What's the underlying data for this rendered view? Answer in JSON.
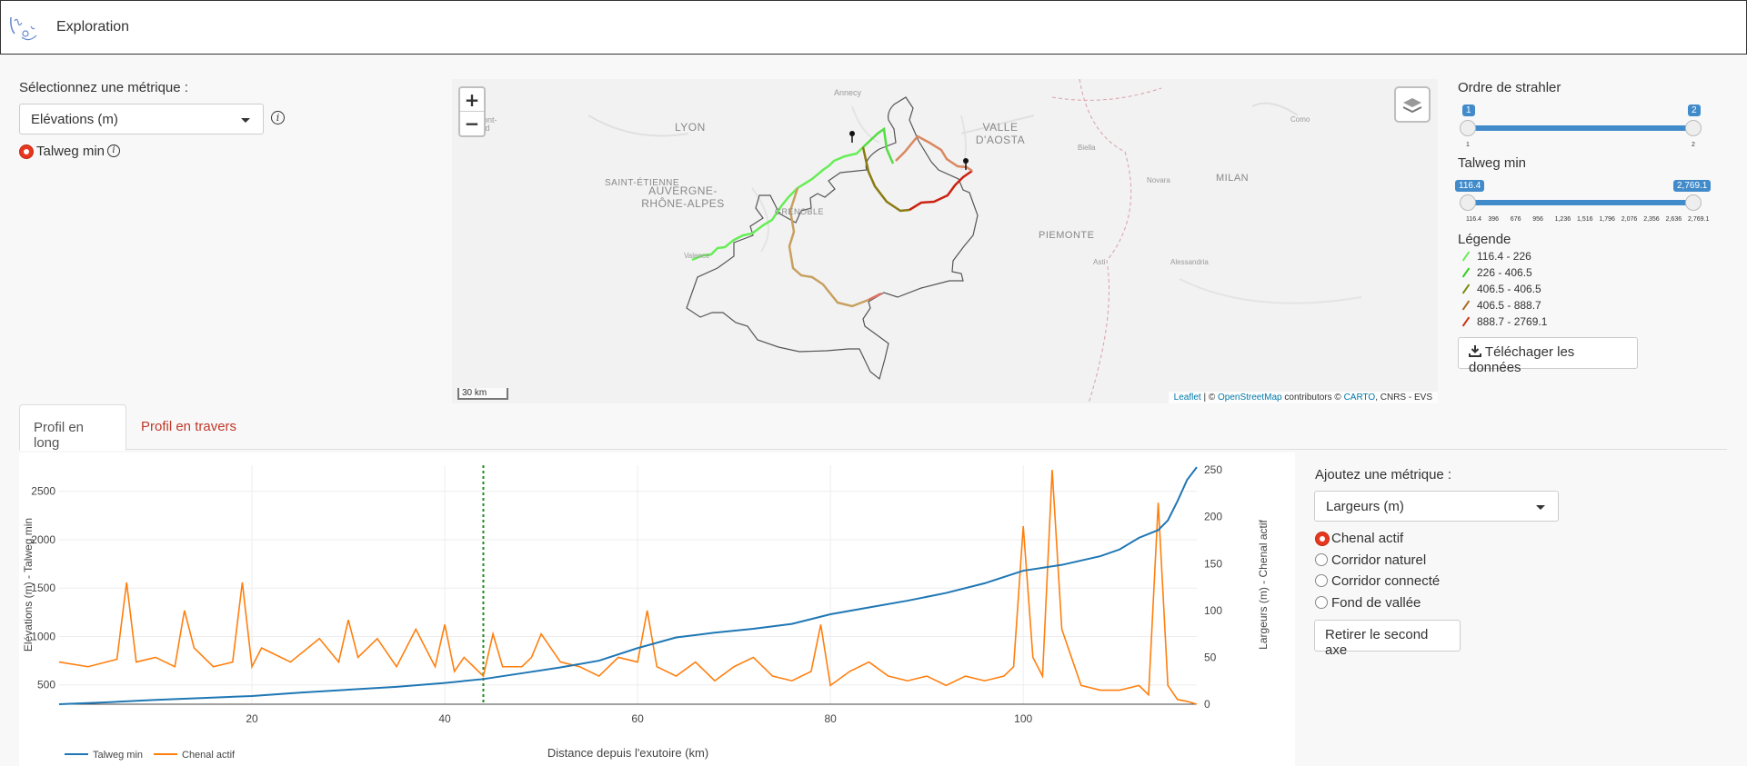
{
  "header": {
    "title": "Exploration"
  },
  "metric_panel": {
    "label": "Sélectionnez une métrique :",
    "select_value": "Elévations (m)",
    "options": [
      "Talweg min"
    ]
  },
  "map": {
    "zoom_in": "+",
    "zoom_out": "−",
    "scale": "30 km",
    "attribution": {
      "leaflet": "Leaflet",
      "sep1": " | © ",
      "osm": "OpenStreetMap",
      "contrib": " contributors © ",
      "carto": "CARTO",
      "rest": ", CNRS - EVS"
    },
    "place_labels": [
      "Annecy",
      "LYON",
      "Clermont-Ferrand",
      "SAINT-ÉTIENNE",
      "AUVERGNE-RHÔNE-ALPES",
      "GRENOBLE",
      "Valence",
      "VALLE D'AOSTA",
      "Biella",
      "Novara",
      "MILAN",
      "Como",
      "PIEMONTE",
      "Asti",
      "Alessandria"
    ]
  },
  "strahler": {
    "title": "Ordre de strahler",
    "min_label": "1",
    "max_label": "2",
    "ticks": [
      "1",
      "2"
    ]
  },
  "talweg": {
    "title": "Talweg min",
    "min_label": "116.4",
    "max_label": "2,769.1",
    "ticks": [
      "116.4",
      "396",
      "676",
      "956",
      "1,236",
      "1,516",
      "1,796",
      "2,076",
      "2,356",
      "2,636",
      "2,769.1"
    ]
  },
  "legend": {
    "title": "Légende",
    "items": [
      {
        "label": "116.4 - 226",
        "color": "#66ee55"
      },
      {
        "label": "226 - 406.5",
        "color": "#33cc22"
      },
      {
        "label": "406.5 - 406.5",
        "color": "#7a8a10"
      },
      {
        "label": "406.5 - 888.7",
        "color": "#a86a20"
      },
      {
        "label": "888.7 - 2769.1",
        "color": "#cc3311"
      }
    ]
  },
  "download_button": "Téléchager les données",
  "tabs": [
    {
      "label": "Profil en long",
      "active": true
    },
    {
      "label": "Profil en travers",
      "active": false
    }
  ],
  "second_metric": {
    "label": "Ajoutez une métrique :",
    "select_value": "Largeurs (m)",
    "options": [
      {
        "label": "Chenal actif",
        "selected": true
      },
      {
        "label": "Corridor naturel",
        "selected": false
      },
      {
        "label": "Corridor connecté",
        "selected": false
      },
      {
        "label": "Fond de vallée",
        "selected": false
      }
    ],
    "remove_button": "Retirer le second axe"
  },
  "colors": {
    "accent": "#428bca",
    "radio": "#e8371f",
    "talweg_line": "#1f77b4",
    "chenal_line": "#ff7f0e",
    "marker": "#228b22"
  },
  "chart_data": {
    "type": "line",
    "xlabel": "Distance depuis l'exutoire (km)",
    "ylabel": "Elévations (m) - Talweg min",
    "y2label": "Largeurs (m) - Chenal actif",
    "xlim": [
      0,
      118
    ],
    "ylim": [
      300,
      2770
    ],
    "y2lim": [
      0,
      255
    ],
    "xticks": [
      20,
      40,
      60,
      80,
      100
    ],
    "yticks": [
      500,
      1000,
      1500,
      2000,
      2500
    ],
    "y2ticks": [
      0,
      50,
      100,
      150,
      200,
      250
    ],
    "marker_x": 44,
    "legend_placement": "bottom-left",
    "grid": true,
    "series": [
      {
        "name": "Talweg min",
        "axis": "y",
        "x": [
          0,
          5,
          10,
          15,
          20,
          25,
          30,
          35,
          40,
          44,
          48,
          52,
          56,
          60,
          64,
          68,
          72,
          76,
          80,
          84,
          88,
          92,
          96,
          100,
          104,
          108,
          110,
          112,
          114,
          115,
          116,
          117,
          118
        ],
        "values": [
          300,
          320,
          345,
          365,
          385,
          420,
          450,
          480,
          520,
          560,
          620,
          680,
          750,
          880,
          990,
          1040,
          1080,
          1130,
          1230,
          1300,
          1370,
          1450,
          1550,
          1680,
          1740,
          1830,
          1900,
          2020,
          2100,
          2200,
          2400,
          2620,
          2750
        ]
      },
      {
        "name": "Chenal actif",
        "axis": "y2",
        "x": [
          0,
          3,
          6,
          7,
          8,
          10,
          12,
          13,
          14,
          16,
          18,
          19,
          20,
          21,
          24,
          27,
          29,
          30,
          31,
          33,
          35,
          37,
          39,
          40,
          41,
          42,
          43,
          44,
          45,
          46,
          48,
          49,
          50,
          52,
          54,
          56,
          58,
          60,
          61,
          62,
          64,
          66,
          68,
          70,
          72,
          74,
          76,
          78,
          79,
          80,
          82,
          84,
          86,
          88,
          90,
          92,
          94,
          96,
          98,
          99,
          100,
          101,
          102,
          103,
          104,
          106,
          108,
          110,
          112,
          113,
          114,
          115,
          116,
          117,
          118
        ],
        "values": [
          45,
          40,
          48,
          130,
          45,
          50,
          40,
          100,
          60,
          40,
          45,
          130,
          40,
          60,
          45,
          70,
          45,
          90,
          50,
          70,
          40,
          80,
          40,
          85,
          35,
          50,
          40,
          30,
          75,
          40,
          40,
          50,
          75,
          45,
          40,
          30,
          50,
          45,
          100,
          40,
          30,
          45,
          25,
          40,
          50,
          30,
          25,
          35,
          85,
          20,
          35,
          45,
          30,
          25,
          30,
          20,
          30,
          25,
          30,
          40,
          190,
          50,
          30,
          250,
          80,
          20,
          15,
          15,
          20,
          10,
          215,
          20,
          5,
          3,
          0
        ]
      }
    ]
  }
}
